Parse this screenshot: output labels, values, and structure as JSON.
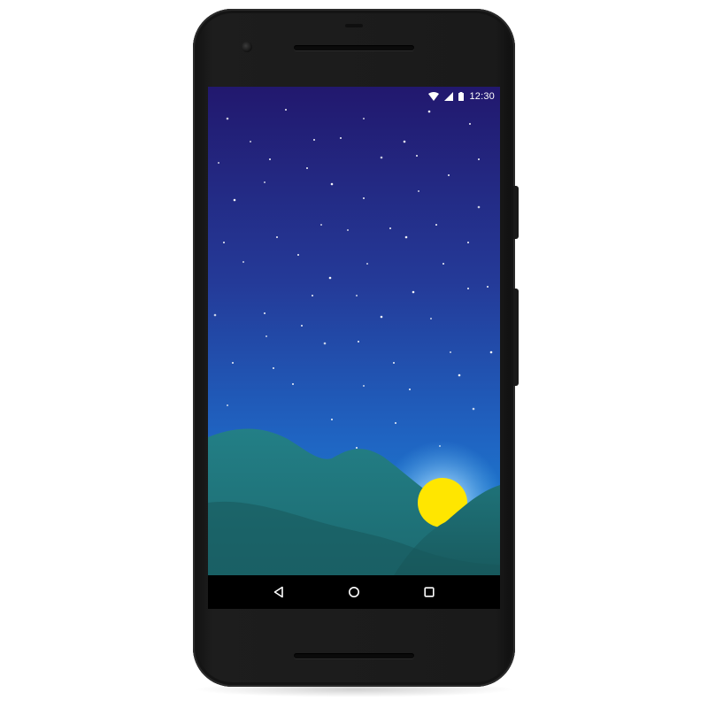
{
  "device": {
    "model": "smartphone",
    "frame_color": "#1a1a1a"
  },
  "status_bar": {
    "time": "12:30",
    "icons": [
      "wifi-icon",
      "cell-signal-icon",
      "battery-icon"
    ],
    "text_color": "#ffffff"
  },
  "wallpaper": {
    "scene": "night-sky-mountains-sunrise",
    "sky_gradient": [
      "#22186e",
      "#243a98",
      "#1f64c2",
      "#1c8ad6"
    ],
    "star_color": "#ffffff",
    "mountain_colors": [
      "#1f7a82",
      "#1d6e74",
      "#1a5f63"
    ],
    "sun_color": "#ffe600",
    "sun_glow_color": "#bfe6ff"
  },
  "nav_bar": {
    "buttons": [
      "back-icon",
      "home-icon",
      "recents-icon"
    ],
    "icon_color": "#ffffff",
    "background": "#000000"
  }
}
